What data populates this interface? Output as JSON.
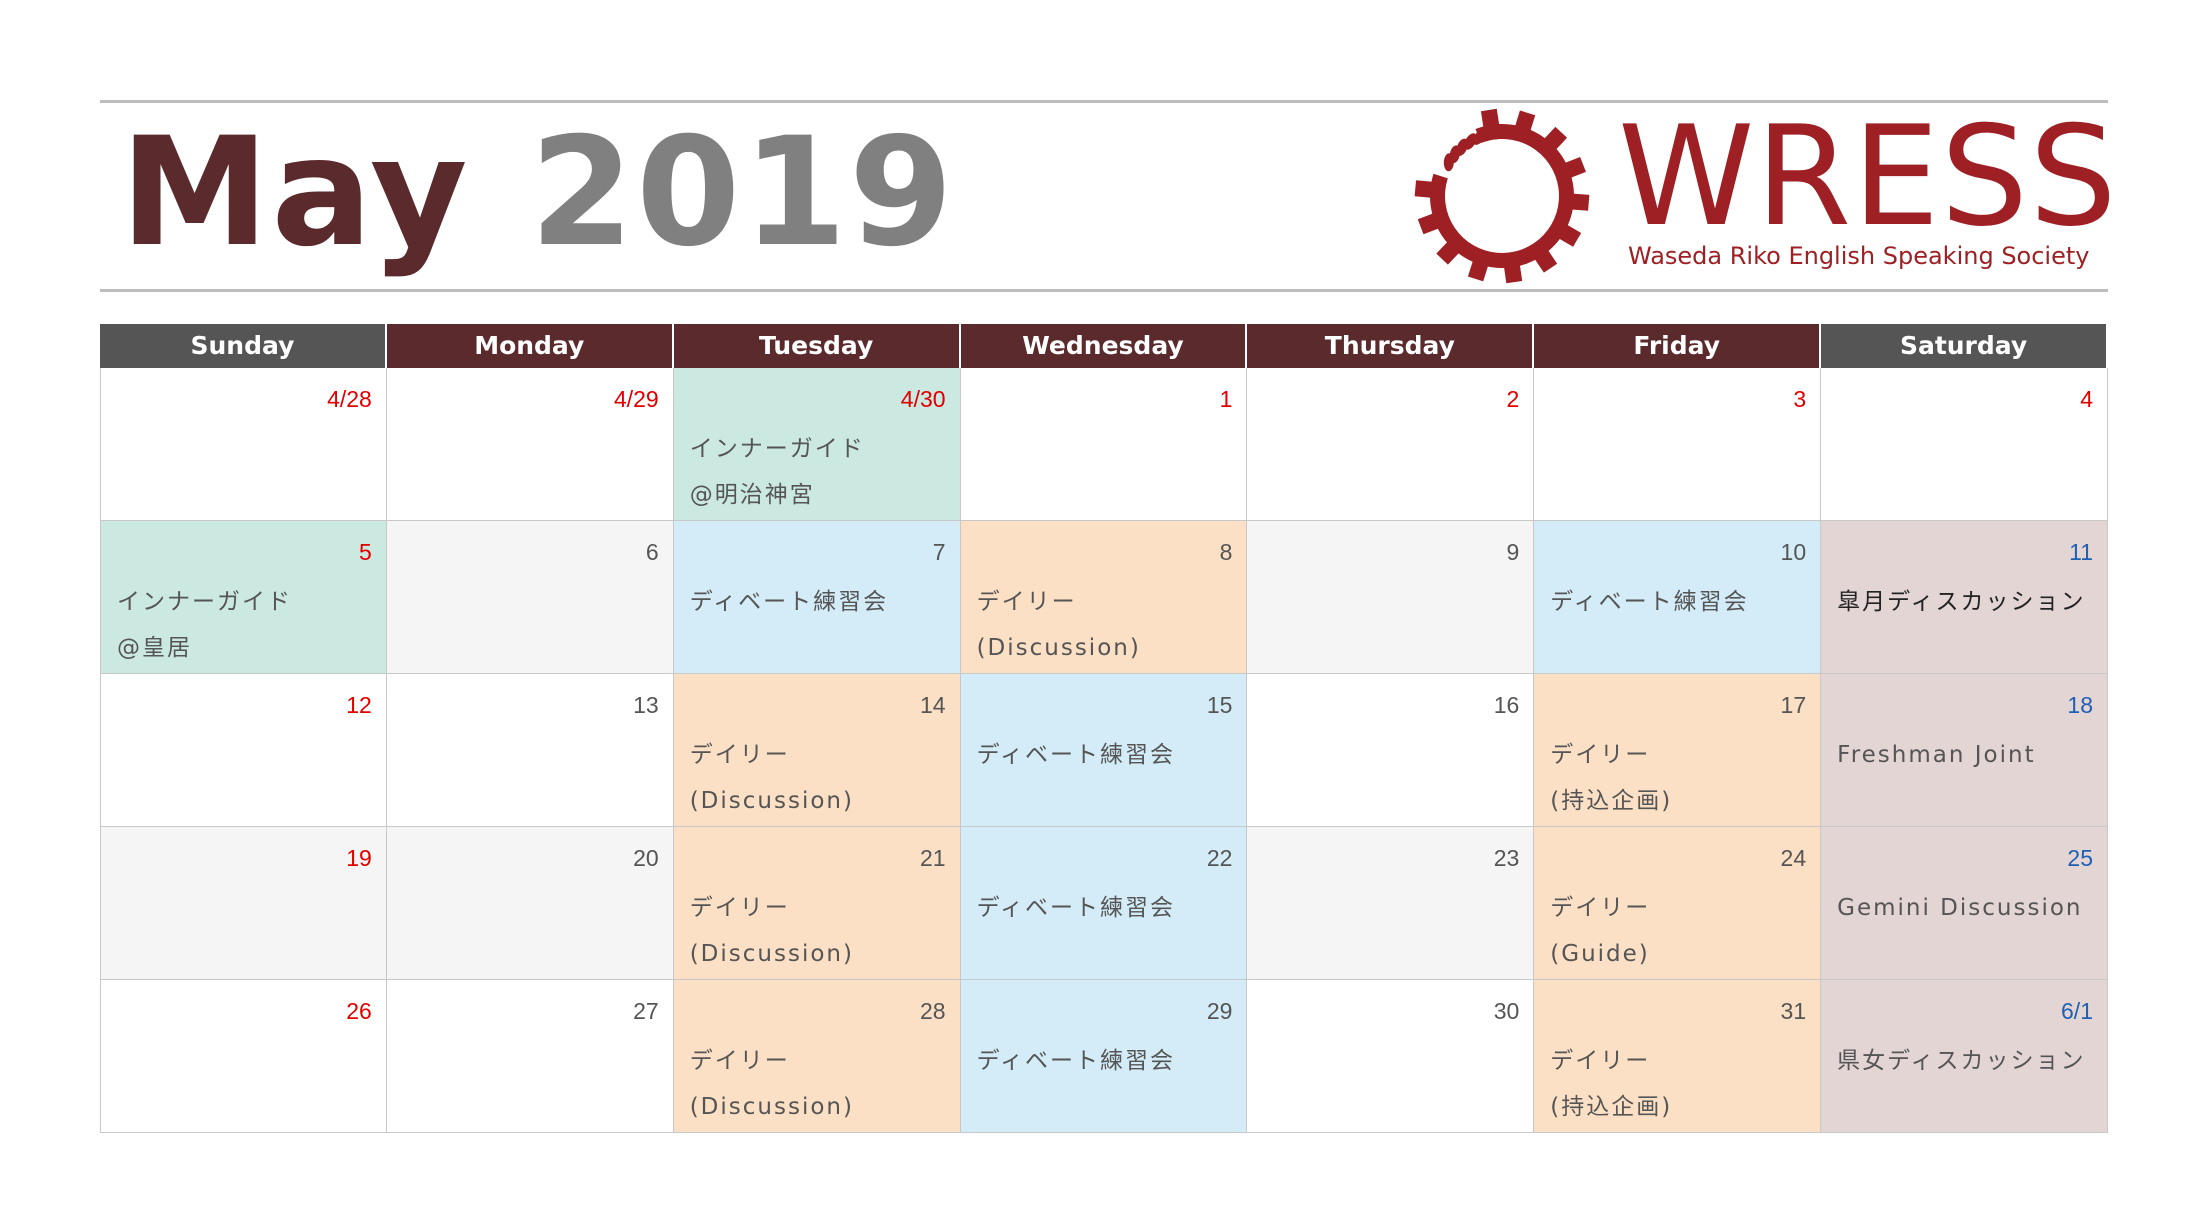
{
  "header": {
    "month": "May",
    "year": "2019"
  },
  "logo": {
    "word": "WRESS",
    "subtitle": "Waseda Riko English Speaking Society",
    "color": "#9e2024",
    "icon": "gear-laurel-icon"
  },
  "weekdays": [
    "Sunday",
    "Monday",
    "Tuesday",
    "Wednesday",
    "Thursday",
    "Friday",
    "Saturday"
  ],
  "colors": {
    "title_month": "#5b2a2c",
    "title_year": "#808080",
    "weekday_dark": "#555555",
    "weekday_red": "#5b2a2c",
    "holiday_red": "#e00000",
    "saturday_blue": "#1f5fb5",
    "mint": "#cbe8e1",
    "blue": "#d3ecf8",
    "peach": "#fbe0c5",
    "rose": "#e3d5d4",
    "gray": "#f5f5f5"
  },
  "weeks": [
    [
      {
        "date": "4/28",
        "lines": []
      },
      {
        "date": "4/29",
        "lines": []
      },
      {
        "date": "4/30",
        "lines": [
          "インナーガイド",
          "@明治神宮"
        ]
      },
      {
        "date": "1",
        "lines": []
      },
      {
        "date": "2",
        "lines": []
      },
      {
        "date": "3",
        "lines": []
      },
      {
        "date": "4",
        "lines": []
      }
    ],
    [
      {
        "date": "5",
        "lines": [
          "インナーガイド",
          "@皇居"
        ]
      },
      {
        "date": "6",
        "lines": []
      },
      {
        "date": "7",
        "lines": [
          "ディベート練習会"
        ]
      },
      {
        "date": "8",
        "lines": [
          "デイリー",
          "(Discussion)"
        ]
      },
      {
        "date": "9",
        "lines": []
      },
      {
        "date": "10",
        "lines": [
          "ディベート練習会"
        ]
      },
      {
        "date": "11",
        "lines": [
          "皐月ディスカッション"
        ]
      }
    ],
    [
      {
        "date": "12",
        "lines": []
      },
      {
        "date": "13",
        "lines": []
      },
      {
        "date": "14",
        "lines": [
          "デイリー",
          "(Discussion)"
        ]
      },
      {
        "date": "15",
        "lines": [
          "ディベート練習会"
        ]
      },
      {
        "date": "16",
        "lines": []
      },
      {
        "date": "17",
        "lines": [
          "デイリー",
          "(持込企画)"
        ]
      },
      {
        "date": "18",
        "lines": [
          "Freshman Joint"
        ]
      }
    ],
    [
      {
        "date": "19",
        "lines": []
      },
      {
        "date": "20",
        "lines": []
      },
      {
        "date": "21",
        "lines": [
          "デイリー",
          "(Discussion)"
        ]
      },
      {
        "date": "22",
        "lines": [
          "ディベート練習会"
        ]
      },
      {
        "date": "23",
        "lines": []
      },
      {
        "date": "24",
        "lines": [
          "デイリー",
          "(Guide)"
        ]
      },
      {
        "date": "25",
        "lines": [
          "Gemini Discussion"
        ]
      }
    ],
    [
      {
        "date": "26",
        "lines": []
      },
      {
        "date": "27",
        "lines": []
      },
      {
        "date": "28",
        "lines": [
          "デイリー",
          "(Discussion)"
        ]
      },
      {
        "date": "29",
        "lines": [
          "ディベート練習会"
        ]
      },
      {
        "date": "30",
        "lines": []
      },
      {
        "date": "31",
        "lines": [
          "デイリー",
          "(持込企画)"
        ]
      },
      {
        "date": "6/1",
        "lines": [
          "県女ディスカッション"
        ]
      }
    ]
  ]
}
